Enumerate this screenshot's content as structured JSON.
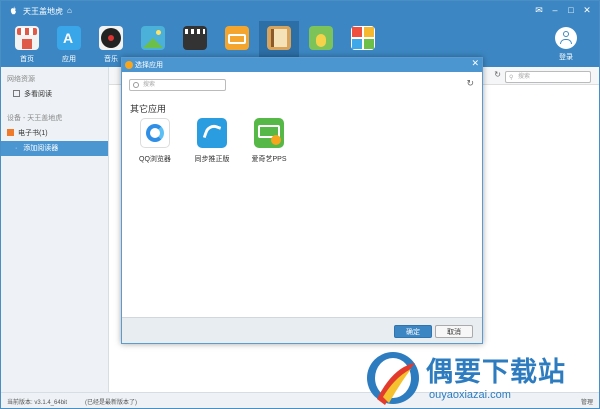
{
  "titlebar": {
    "title": "天王盖地虎",
    "home_icon": "home-icon",
    "buttons": [
      "message-icon",
      "minimize-icon",
      "maximize-icon",
      "close-icon"
    ]
  },
  "toolbar": {
    "items": [
      {
        "label": "首页",
        "icon": "shop-icon",
        "color": "#e05a4a"
      },
      {
        "label": "应用",
        "icon": "app-store-icon",
        "color": "#38a6e8"
      },
      {
        "label": "音乐",
        "icon": "music-icon",
        "color": "#222222"
      },
      {
        "label": "",
        "icon": "photo-icon",
        "color": "#4bb1d8"
      },
      {
        "label": "",
        "icon": "video-icon",
        "color": "#333333"
      },
      {
        "label": "",
        "icon": "wallet-icon",
        "color": "#f3a52e"
      },
      {
        "label": "",
        "icon": "book-icon",
        "color": "#d8a45c"
      },
      {
        "label": "",
        "icon": "pineapple-icon",
        "color": "#7cc35a"
      },
      {
        "label": "",
        "icon": "tiles-icon",
        "color": "#ef7a3e"
      }
    ],
    "login_label": "登录"
  },
  "sidebar": {
    "section1": "网络资源",
    "item_multi": "多看阅读",
    "section2": "设备 - 天王盖地虎",
    "item_ebook": "电子书(1)",
    "item_add_reader": "添加阅读器"
  },
  "main": {
    "search_placeholder": "搜索"
  },
  "dialog": {
    "title": "选择应用",
    "search_placeholder": "搜索",
    "section_title": "其它应用",
    "apps": [
      {
        "label": "QQ浏览器",
        "icon": "qq-browser-icon",
        "color": "#2f8fe6"
      },
      {
        "label": "同步推正版",
        "icon": "tongbutui-icon",
        "color": "#2a9ce0"
      },
      {
        "label": "爱奇艺PPS",
        "icon": "iqiyi-pps-icon",
        "color": "#56b847"
      }
    ],
    "ok": "确定",
    "cancel": "取消"
  },
  "statusbar": {
    "version": "当前版本: v3.1.4_64bit",
    "note": "(已经是最新版本了)",
    "manage": "管理"
  },
  "watermark": {
    "text": "偶要下载站",
    "url": "ouyaoxiazai.com"
  }
}
